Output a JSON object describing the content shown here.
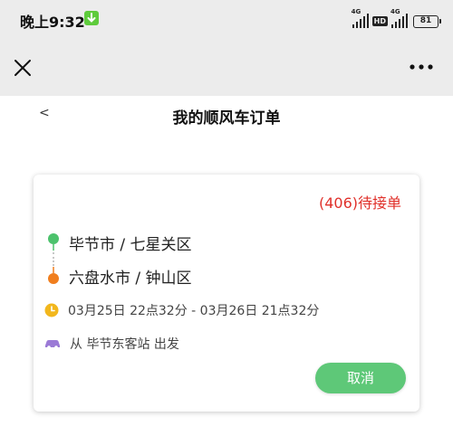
{
  "status_bar": {
    "time": "晚上9:32",
    "network_tags": [
      "4G",
      "4G"
    ],
    "hd_label": "HD",
    "battery": "81"
  },
  "toolbar": {
    "close_icon": "close-icon",
    "more_icon": "more-dots-icon"
  },
  "header": {
    "back_label": "<",
    "title": "我的顺风车订单"
  },
  "order": {
    "status": "(406)待接单",
    "from": "毕节市 / 七星关区",
    "to": "六盘水市 / 钟山区",
    "time_range": "03月25日 22点32分 - 03月26日 21点32分",
    "departure": "从 毕节东客站 出发",
    "cancel_label": "取消"
  },
  "colors": {
    "accent_green": "#5ec878",
    "status_red": "#e0302a",
    "origin_pin": "#4cc26c",
    "dest_pin": "#f07e1e",
    "clock": "#f2b71d",
    "car": "#9b7ad6"
  }
}
